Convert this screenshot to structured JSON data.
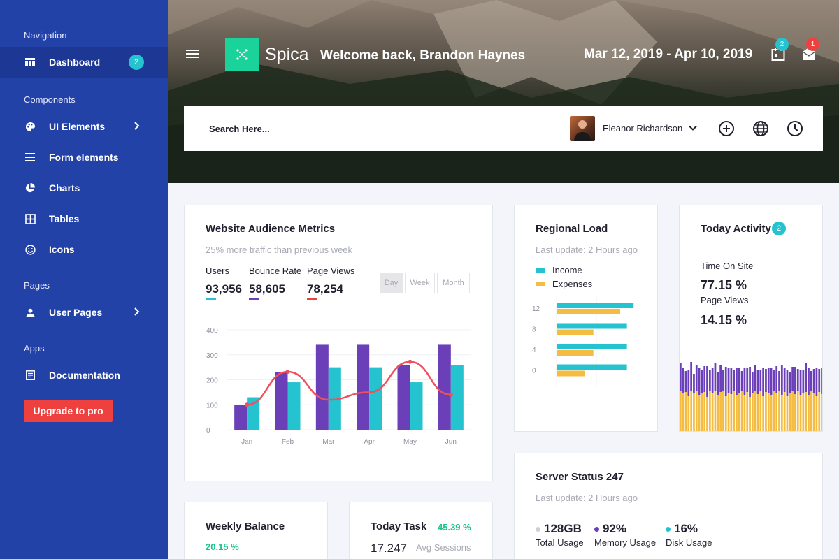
{
  "sidebar": {
    "sections": [
      "Navigation",
      "Components",
      "Pages",
      "Apps"
    ],
    "items": [
      {
        "label": "Dashboard",
        "icon": "dashboard-icon",
        "badge": "2"
      },
      {
        "label": "UI Elements",
        "icon": "palette-icon"
      },
      {
        "label": "Form elements",
        "icon": "list-icon"
      },
      {
        "label": "Charts",
        "icon": "pie-chart-icon"
      },
      {
        "label": "Tables",
        "icon": "table-icon"
      },
      {
        "label": "Icons",
        "icon": "smile-icon"
      },
      {
        "label": "User Pages",
        "icon": "user-icon"
      },
      {
        "label": "Documentation",
        "icon": "document-icon"
      }
    ],
    "upgrade_label": "Upgrade to pro"
  },
  "header": {
    "logo_text": "Spica",
    "welcome": "Welcome back, Brandon Haynes",
    "date_range": "Mar 12, 2019 - Apr 10, 2019",
    "notifications_badge": "2",
    "messages_badge": "1"
  },
  "searchbar": {
    "placeholder": "Search Here...",
    "user_name": "Eleanor Richardson"
  },
  "audience": {
    "title": "Website Audience Metrics",
    "subtitle": "25% more traffic than previous week",
    "metrics": [
      {
        "label": "Users",
        "value": "93,956",
        "color": "#24c3cf"
      },
      {
        "label": "Bounce Rate",
        "value": "58,605",
        "color": "#6a3fb8"
      },
      {
        "label": "Page Views",
        "value": "78,254",
        "color": "#ef4040"
      }
    ],
    "ranges": [
      "Day",
      "Week",
      "Month"
    ]
  },
  "regional": {
    "title": "Regional Load",
    "subtitle": "Last update: 2 Hours ago",
    "legend": [
      {
        "label": "Income",
        "color": "#24c3cf"
      },
      {
        "label": "Expenses",
        "color": "#f4bc42"
      }
    ]
  },
  "activity": {
    "title": "Today Activity",
    "badge": "2",
    "time_label": "Time On Site",
    "time_value": "77.15 %",
    "views_label": "Page Views",
    "views_value": "14.15 %"
  },
  "server": {
    "title": "Server Status 247",
    "subtitle": "Last update: 2 Hours ago",
    "stats": [
      {
        "value": "128GB",
        "label": "Total Usage",
        "color": "#cfd0d6"
      },
      {
        "value": "92%",
        "label": "Memory Usage",
        "color": "#6a3fb8"
      },
      {
        "value": "16%",
        "label": "Disk Usage",
        "color": "#24c3cf"
      }
    ]
  },
  "weekly": {
    "title": "Weekly Balance",
    "percent": "20.15 %"
  },
  "task": {
    "title": "Today Task",
    "percent": "45.39 %",
    "value": "17.247",
    "value_label": "Avg Sessions"
  },
  "chart_data": [
    {
      "type": "bar",
      "categories": [
        "Jan",
        "Feb",
        "Mar",
        "Apr",
        "May",
        "Jun"
      ],
      "ylim": [
        0,
        400
      ],
      "yticks": [
        0,
        100,
        200,
        300,
        400
      ],
      "series": [
        {
          "values": [
            100,
            230,
            340,
            340,
            260,
            340
          ],
          "color": "#6a3fb8"
        },
        {
          "values": [
            130,
            190,
            250,
            250,
            190,
            260
          ],
          "color": "#24c3cf"
        },
        {
          "values": [
            100,
            232,
            120,
            150,
            272,
            140
          ],
          "color": "#ef4f5e",
          "kind": "line"
        }
      ]
    },
    {
      "type": "bar",
      "orientation": "horizontal",
      "categories": [
        "12",
        "8",
        "4",
        "0"
      ],
      "xlim": [
        0,
        12
      ],
      "series": [
        {
          "name": "Income",
          "values": [
            11.5,
            10.5,
            10.5,
            10.5
          ],
          "color": "#24c3cf"
        },
        {
          "name": "Expenses",
          "values": [
            9.5,
            5.5,
            5.5,
            4.2
          ],
          "color": "#f4bc42"
        }
      ]
    },
    {
      "type": "bar",
      "stacked": true,
      "ylim": [
        0,
        100
      ],
      "series": [
        {
          "values": [
            60,
            57,
            58,
            52,
            59,
            56,
            60,
            53,
            57,
            58,
            51,
            60,
            56,
            59,
            54,
            58,
            60,
            52,
            57,
            55,
            59,
            53,
            56,
            60,
            54,
            58,
            51,
            57,
            59,
            55,
            60,
            52,
            58,
            56,
            53,
            59,
            57,
            60,
            54,
            58,
            52,
            56,
            59,
            55,
            60,
            53,
            57,
            58,
            54,
            60,
            56,
            52,
            58,
            55
          ],
          "color": "#f4bc42"
        },
        {
          "values": [
            40,
            35,
            30,
            38,
            42,
            28,
            36,
            40,
            32,
            37,
            44,
            30,
            36,
            41,
            33,
            38,
            29,
            42,
            35,
            37,
            31,
            40,
            36,
            28,
            39,
            34,
            43,
            30,
            37,
            35,
            29,
            41,
            33,
            36,
            40,
            31,
            38,
            28,
            42,
            34,
            37,
            30,
            35,
            39,
            31,
            36,
            32,
            41,
            38,
            28,
            35,
            40,
            33,
            37
          ],
          "color": "#6a3fb8"
        }
      ]
    }
  ]
}
